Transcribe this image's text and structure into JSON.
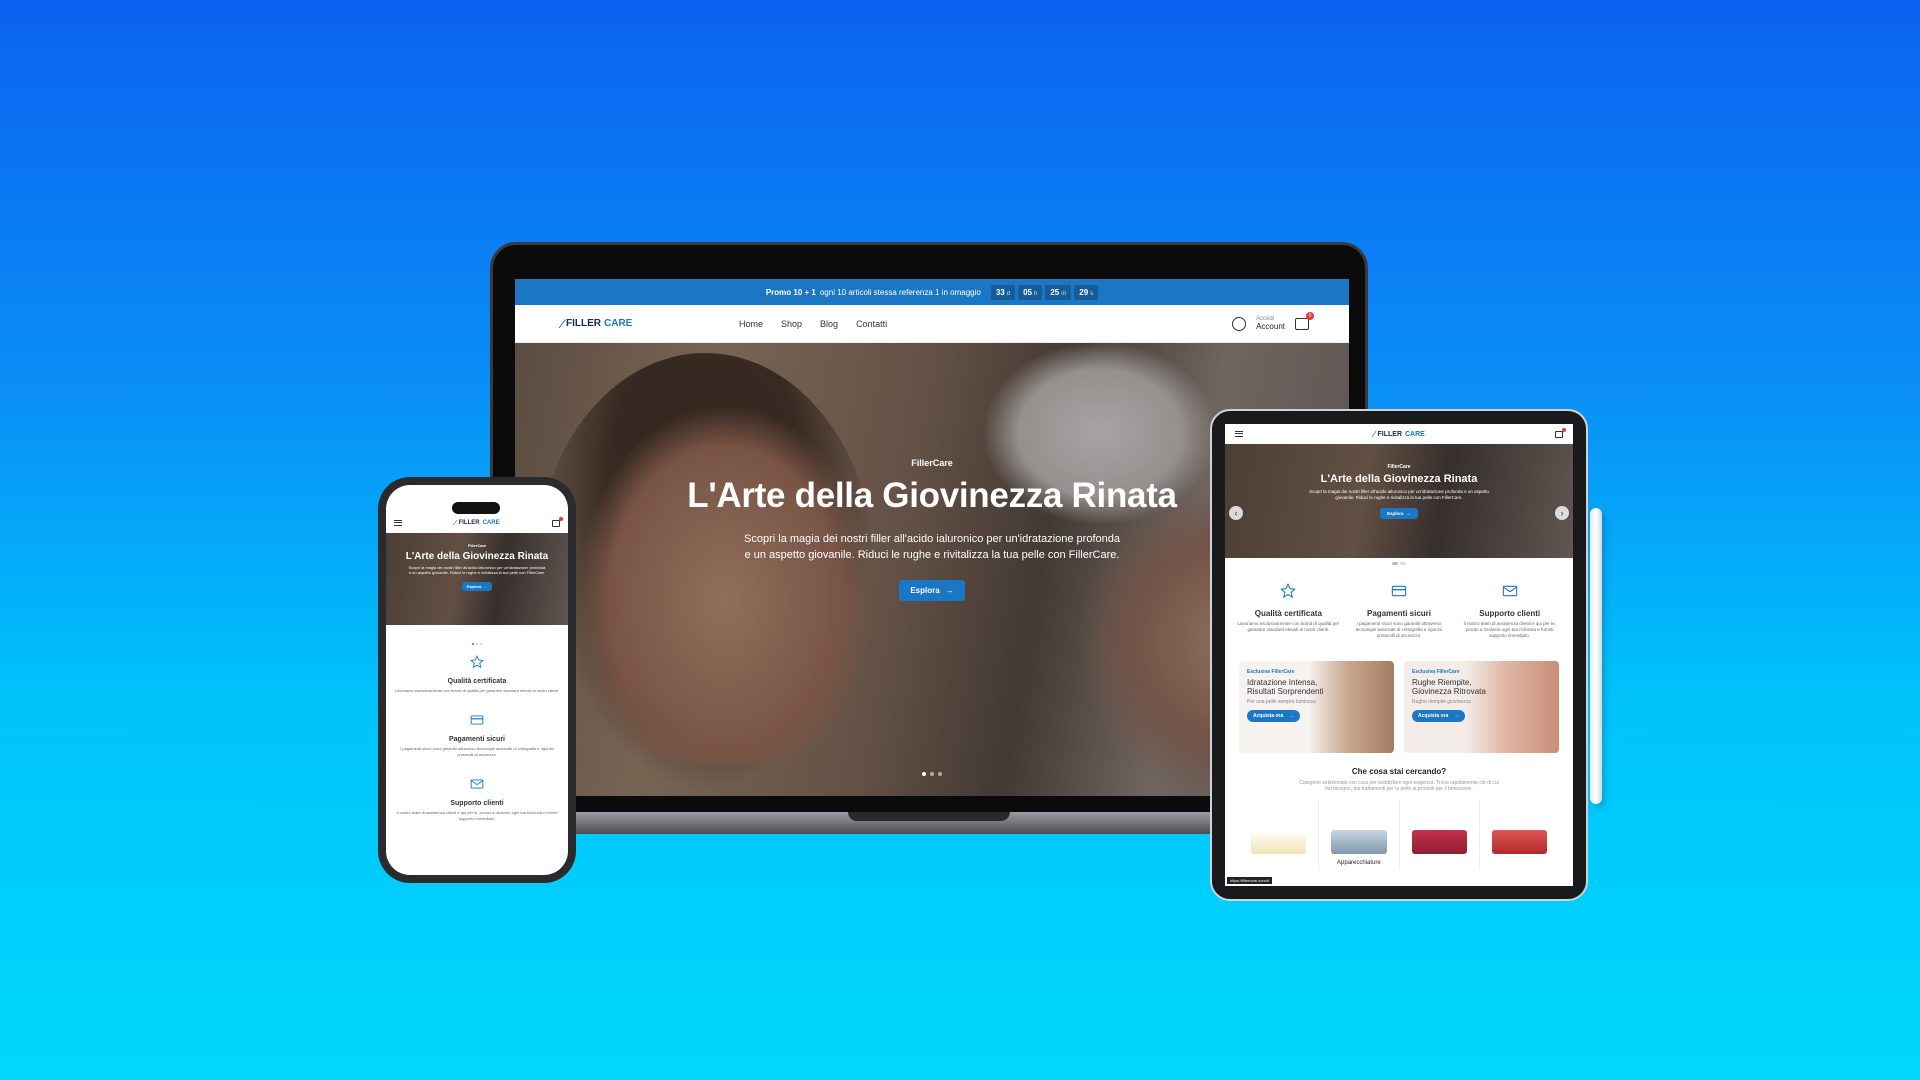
{
  "promo": {
    "label_bold": "Promo 10 + 1",
    "label": "ogni 10 articoli stessa referenza 1 in omaggio",
    "timer": [
      {
        "value": "33",
        "unit": "d"
      },
      {
        "value": "05",
        "unit": "h"
      },
      {
        "value": "25",
        "unit": "m"
      },
      {
        "value": "29",
        "unit": "s"
      }
    ]
  },
  "brand": {
    "word1": "FILLER",
    "word2": "CARE"
  },
  "nav": {
    "items": [
      "Home",
      "Shop",
      "Blog",
      "Contatti"
    ],
    "account_small": "Accedi",
    "account": "Account",
    "cart_count": "0"
  },
  "hero": {
    "eyebrow": "FillerCare",
    "title": "L'Arte della Giovinezza Rinata",
    "text": "Scopri la magia dei nostri filler all'acido ialuronico per un'idratazione profonda e un aspetto giovanile. Riduci le rughe e rivitalizza la tua pelle con FillerCare.",
    "button": "Esplora",
    "button_arrow": "→"
  },
  "features": [
    {
      "icon": "star-icon",
      "title": "Qualità certificata",
      "text": "Lavoriamo esclusivamente con brand di qualità per garantire standard elevati ai nostri clienti."
    },
    {
      "icon": "credit-card-icon",
      "title": "Pagamenti sicuri",
      "text": "I pagamenti sicuri sono garantiti attraverso tecnologie avanzate di crittografia e rigorosi protocolli di sicurezza."
    },
    {
      "icon": "envelope-icon",
      "title": "Supporto clienti",
      "text": "Il nostro team di assistenza clienti è qui per te, pronto a risolvere ogni tua richiesta e fornirti supporto immediato."
    }
  ],
  "categories": [
    {
      "tag": "Esclusiva FillerCare",
      "title": "Idratazione Intensa, Risultati Sorprendenti",
      "sub": "Per una pelle sempre luminosa",
      "button": "Acquista ora"
    },
    {
      "tag": "Esclusiva FillerCare",
      "title": "Rughe Riempite, Giovinezza Ritrovata",
      "sub": "Rughe riempite giovinezza",
      "button": "Acquista ora"
    }
  ],
  "search_section": {
    "title": "Che cosa stai cercando?",
    "text": "Categorie selezionate con cura per soddisfare ogni esigenza. Trova rapidamente ciò di cui hai bisogno, dai trattamenti per la pelle ai prodotti per il benessere."
  },
  "products": [
    {
      "label": ""
    },
    {
      "label": "Apparecchiature"
    },
    {
      "label": ""
    },
    {
      "label": ""
    }
  ],
  "status_url": "https://fillercare.com/#",
  "colors": {
    "primary": "#1b76c4",
    "badge": "#e53935"
  }
}
